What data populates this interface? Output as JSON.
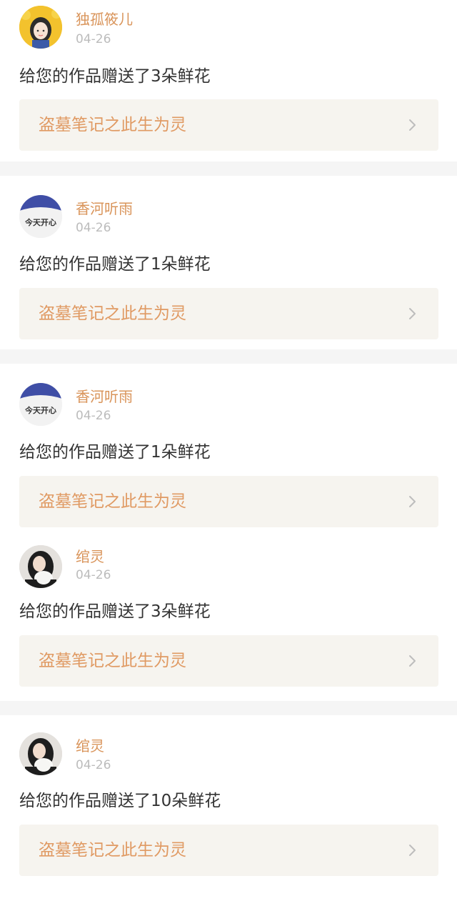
{
  "items": [
    {
      "user": "独孤筱儿",
      "date": "04-26",
      "message": "给您的作品赠送了3朵鲜花",
      "work_title": "盗墓笔记之此生为灵",
      "avatar_icon": "cartoon-girl-avatar"
    },
    {
      "user": "香河听雨",
      "date": "04-26",
      "message": "给您的作品赠送了1朵鲜花",
      "work_title": "盗墓笔记之此生为灵",
      "avatar_icon": "handwriting-avatar",
      "avatar_text": "今天开心"
    },
    {
      "user": "香河听雨",
      "date": "04-26",
      "message": "给您的作品赠送了1朵鲜花",
      "work_title": "盗墓笔记之此生为灵",
      "avatar_icon": "handwriting-avatar",
      "avatar_text": "今天开心"
    },
    {
      "user": "绾灵",
      "date": "04-26",
      "message": "给您的作品赠送了3朵鲜花",
      "work_title": "盗墓笔记之此生为灵",
      "avatar_icon": "girl-photo-avatar"
    },
    {
      "user": "绾灵",
      "date": "04-26",
      "message": "给您的作品赠送了10朵鲜花",
      "work_title": "盗墓笔记之此生为灵",
      "avatar_icon": "girl-photo-avatar"
    }
  ],
  "colors": {
    "username": "#d9945a",
    "date": "#bcbcbc",
    "message": "#333333",
    "work_title": "#e09a63",
    "work_bg": "#f6f4ef",
    "separator": "#f5f5f5"
  }
}
